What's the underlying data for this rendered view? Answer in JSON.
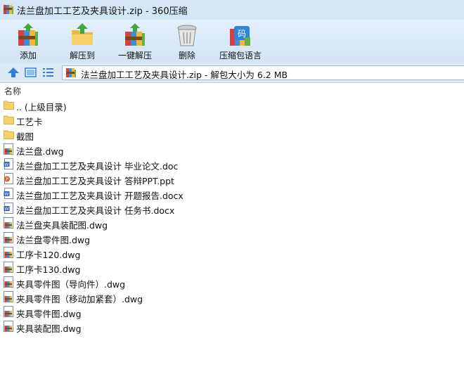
{
  "window": {
    "title": "法兰盘加工工艺及夹具设计.zip - 360压缩",
    "app_icon": "archive-app-icon"
  },
  "toolbar": {
    "buttons": [
      {
        "label": "添加",
        "icon": "add-books-icon"
      },
      {
        "label": "解压到",
        "icon": "extract-to-icon"
      },
      {
        "label": "一键解压",
        "icon": "one-click-extract-icon"
      },
      {
        "label": "删除",
        "icon": "trash-can-icon"
      },
      {
        "label": "压缩包语言",
        "icon": "archive-language-icon"
      }
    ]
  },
  "addressbar": {
    "path_text": "法兰盘加工工艺及夹具设计.zip - 解包大小为 6.2 MB",
    "nav_icons": [
      "up-arrow-icon",
      "view-thumbnail-icon",
      "view-list-icon"
    ]
  },
  "filelist": {
    "column_header": "名称",
    "items": [
      {
        "name": ".. (上级目录)",
        "type": "folder"
      },
      {
        "name": "工艺卡",
        "type": "folder"
      },
      {
        "name": "截图",
        "type": "folder"
      },
      {
        "name": "法兰盘.dwg",
        "type": "dwg"
      },
      {
        "name": "法兰盘加工工艺及夹具设计 毕业论文.doc",
        "type": "doc"
      },
      {
        "name": "法兰盘加工工艺及夹具设计 答辩PPT.ppt",
        "type": "ppt"
      },
      {
        "name": "法兰盘加工工艺及夹具设计 开题报告.docx",
        "type": "doc"
      },
      {
        "name": "法兰盘加工工艺及夹具设计 任务书.docx",
        "type": "doc"
      },
      {
        "name": "法兰盘夹具装配图.dwg",
        "type": "dwg"
      },
      {
        "name": "法兰盘零件图.dwg",
        "type": "dwg"
      },
      {
        "name": "工序卡120.dwg",
        "type": "dwg"
      },
      {
        "name": "工序卡130.dwg",
        "type": "dwg"
      },
      {
        "name": "夹具零件图（导向件）.dwg",
        "type": "dwg"
      },
      {
        "name": "夹具零件图（移动加紧套）.dwg",
        "type": "dwg"
      },
      {
        "name": "夹具零件图.dwg",
        "type": "dwg"
      },
      {
        "name": "夹具装配图.dwg",
        "type": "dwg"
      }
    ]
  },
  "colors": {
    "titlebar_bg": "#d5e6f7",
    "toolbar_bg": "#dbe9f8",
    "folder": "#f5d77e",
    "accent_blue": "#2f7fd8"
  }
}
